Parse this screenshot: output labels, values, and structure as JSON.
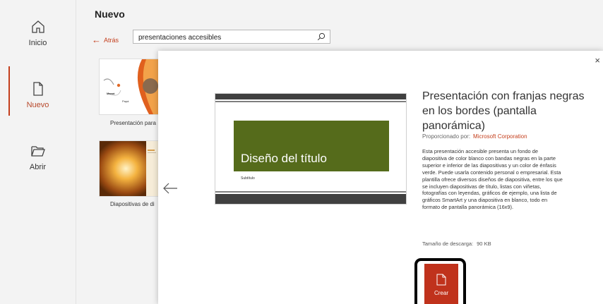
{
  "nav": {
    "items": [
      {
        "label": "Inicio",
        "icon": "home-icon"
      },
      {
        "label": "Nuevo",
        "icon": "new-file-icon"
      },
      {
        "label": "Abrir",
        "icon": "open-folder-icon"
      }
    ],
    "active": "Nuevo"
  },
  "main": {
    "title": "Nuevo",
    "back_label": "Atrás",
    "search": {
      "value": "presentaciones accesibles",
      "placeholder": ""
    },
    "thumbnails": [
      {
        "label": "Presentación para",
        "text1": "Mamá",
        "text2": "Papá"
      },
      {
        "label": "Diapositivas de di"
      }
    ]
  },
  "dialog": {
    "title": "Presentación con franjas negras en los bordes (pantalla panorámica)",
    "provider_label": "Proporcionado por:",
    "provider_value": "Microsoft Corporation",
    "description": "Esta presentación accesible presenta un fondo de diapositiva de color blanco con bandas negras en la parte superior e inferior de las diapositivas y un color de énfasis verde. Puede usarla contenido personal o empresarial. Esta plantilla ofrece diversos diseños de diapositiva, entre los que se incluyen diapositivas de título, listas con viñetas, fotografías con leyendas, gráficos de ejemplo, una lista de gráficos SmartArt y una diapositiva en blanco, todo en formato de pantalla panorámica (16x9).",
    "download_size_label": "Tamaño de descarga:",
    "download_size_value": "90 KB",
    "create_label": "Crear",
    "close_glyph": "×",
    "preview": {
      "title": "Diseño del título",
      "subtitle": "Subtítulo"
    }
  },
  "colors": {
    "accent": "#c43e1c",
    "title_box": "#556b1b",
    "band": "#404040"
  }
}
